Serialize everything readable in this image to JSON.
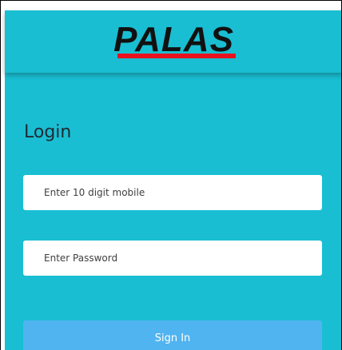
{
  "header": {
    "logo_text": "PALAS"
  },
  "login": {
    "title": "Login",
    "mobile_placeholder": "Enter 10 digit mobile",
    "mobile_value": "",
    "password_placeholder": "Enter Password",
    "password_value": "",
    "signin_label": "Sign In"
  },
  "colors": {
    "background": "#19bed2",
    "logo_underline": "#e8121e",
    "signin_button": "#50b4f0",
    "field_background": "#ffffff"
  }
}
